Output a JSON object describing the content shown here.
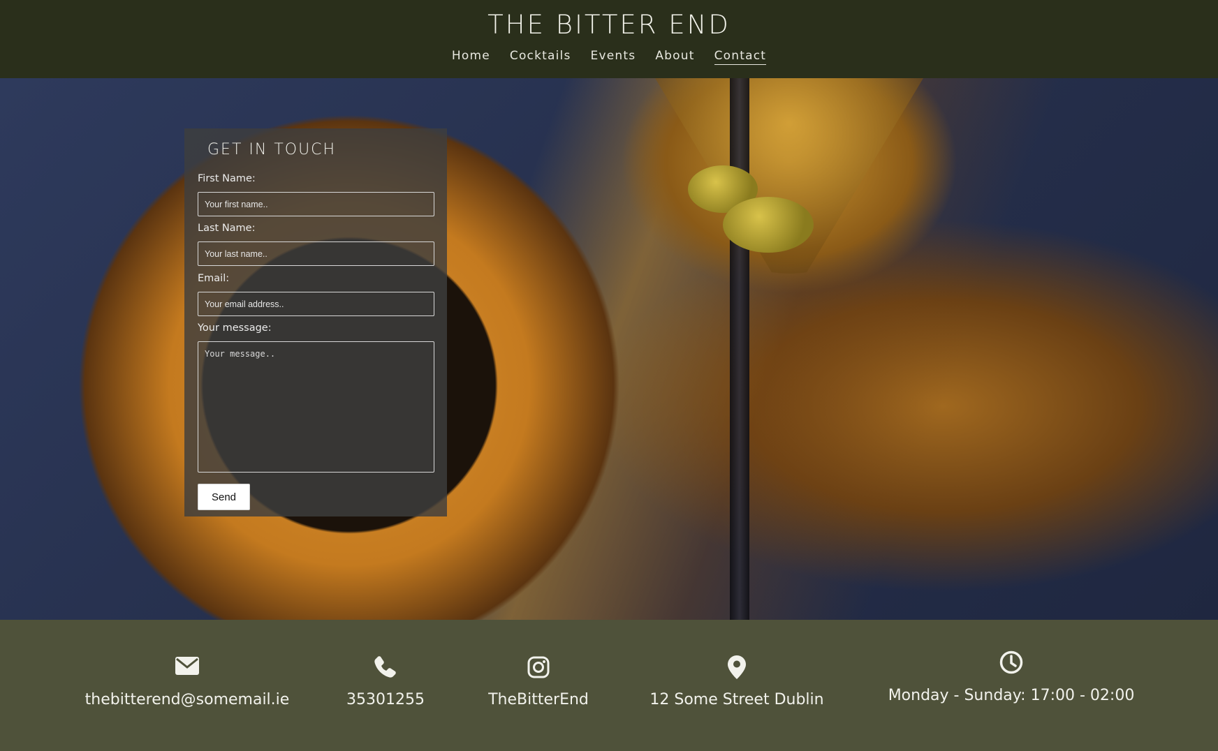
{
  "header": {
    "title": "THE BITTER END",
    "nav": [
      {
        "label": "Home",
        "active": false
      },
      {
        "label": "Cocktails",
        "active": false
      },
      {
        "label": "Events",
        "active": false
      },
      {
        "label": "About",
        "active": false
      },
      {
        "label": "Contact",
        "active": true
      }
    ]
  },
  "form": {
    "title": "GET IN TOUCH",
    "first_name": {
      "label": "First Name:",
      "placeholder": "Your first name.."
    },
    "last_name": {
      "label": "Last Name:",
      "placeholder": "Your last name.."
    },
    "email": {
      "label": "Email:",
      "placeholder": "Your email address.."
    },
    "message": {
      "label": "Your message:",
      "placeholder": "Your message.."
    },
    "send_label": "Send"
  },
  "footer": {
    "email": {
      "icon": "envelope-icon",
      "text": "thebitterend@somemail.ie"
    },
    "phone": {
      "icon": "phone-icon",
      "text": "35301255"
    },
    "instagram": {
      "icon": "instagram-icon",
      "text": "TheBitterEnd"
    },
    "address": {
      "icon": "map-pin-icon",
      "text": "12 Some Street Dublin"
    },
    "hours": {
      "icon": "clock-icon",
      "text": "Monday - Sunday: 17:00 - 02:00"
    }
  },
  "colors": {
    "header_bg": "#2a2f1b",
    "footer_bg": "#4f523a",
    "panel_bg": "#3e3e3e"
  }
}
